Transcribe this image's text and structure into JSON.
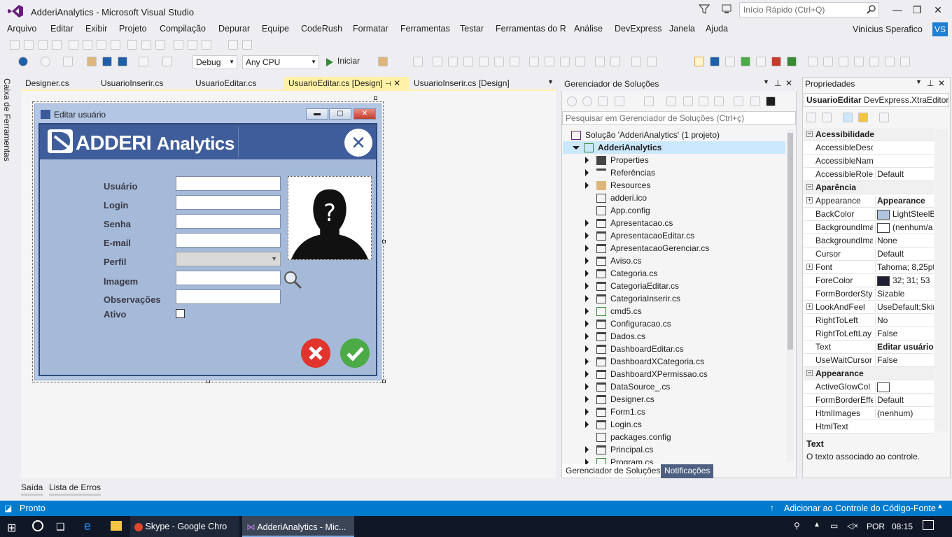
{
  "window": {
    "title": "AdderiAnalytics - Microsoft Visual Studio",
    "quick_launch": "Início Rápido (Ctrl+Q)",
    "user": "Vinícius Sperafico",
    "initials": "VS"
  },
  "menu": [
    "Arquivo",
    "Editar",
    "Exibir",
    "Projeto",
    "Compilação",
    "Depurar",
    "Equipe",
    "CodeRush",
    "Formatar",
    "Ferramentas",
    "Testar",
    "Ferramentas do R",
    "Análise",
    "DevExpress",
    "Janela",
    "Ajuda"
  ],
  "toolbar": {
    "config": "Debug",
    "platform": "Any CPU",
    "start": "Iniciar"
  },
  "toolbox_label": "Caixa de Ferramentas",
  "doc_tabs": [
    "Designer.cs",
    "UsuarioInserir.cs",
    "UsuarioEditar.cs",
    "UsuarioEditar.cs [Design]",
    "UsuarioInserir.cs [Design]"
  ],
  "form": {
    "title": "Editar usuário",
    "logo_main": "ADDERI",
    "logo_sub": "Analytics",
    "fields": [
      "Usuário",
      "Login",
      "Senha",
      "E-mail",
      "Perfil",
      "Imagem",
      "Observações",
      "Ativo"
    ]
  },
  "solution": {
    "title": "Gerenciador de Soluções",
    "search": "Pesquisar em Gerenciador de Soluções (Ctrl+ç)",
    "solution_label": "Solução 'AdderiAnalytics' (1 projeto)",
    "project": "AdderiAnalytics",
    "items": [
      "Properties",
      "Referências",
      "Resources",
      "adderi.ico",
      "App.config",
      "Apresentacao.cs",
      "ApresentacaoEditar.cs",
      "ApresentacaoGerenciar.cs",
      "Aviso.cs",
      "Categoria.cs",
      "CategoriaEditar.cs",
      "CategoriaInserir.cs",
      "cmd5.cs",
      "Configuracao.cs",
      "Dados.cs",
      "DashboardEditar.cs",
      "DashboardXCategoria.cs",
      "DashboardXPermissao.cs",
      "DataSource_.cs",
      "Designer.cs",
      "Form1.cs",
      "Login.cs",
      "packages.config",
      "Principal.cs",
      "Program.cs"
    ],
    "tabs": [
      "Gerenciador de Soluções",
      "Notificações"
    ]
  },
  "properties": {
    "title": "Propriedades",
    "object": "UsuarioEditar",
    "object_type": "DevExpress.XtraEditors",
    "rows": [
      {
        "cat": "Acessibilidade"
      },
      {
        "n": "AccessibleDesc",
        "v": ""
      },
      {
        "n": "AccessibleNam",
        "v": ""
      },
      {
        "n": "AccessibleRole",
        "v": "Default"
      },
      {
        "cat": "Aparência"
      },
      {
        "n": "Appearance",
        "v": "Appearance",
        "plus": true,
        "bold": true
      },
      {
        "n": "BackColor",
        "v": "LightSteelB",
        "swatch": "#b0c4de"
      },
      {
        "n": "BackgroundIma",
        "v": "(nenhum/a",
        "swatch": "#ffffff"
      },
      {
        "n": "BackgroundIma",
        "v": "None"
      },
      {
        "n": "Cursor",
        "v": "Default"
      },
      {
        "n": "Font",
        "v": "Tahoma; 8,25pt",
        "plus": true
      },
      {
        "n": "ForeColor",
        "v": "32; 31; 53",
        "swatch": "#201f35"
      },
      {
        "n": "FormBorderSty",
        "v": "Sizable"
      },
      {
        "n": "LookAndFeel",
        "v": "UseDefault;Skin:",
        "plus": true
      },
      {
        "n": "RightToLeft",
        "v": "No"
      },
      {
        "n": "RightToLeftLay",
        "v": "False"
      },
      {
        "n": "Text",
        "v": "Editar usuário",
        "bold": true
      },
      {
        "n": "UseWaitCursor",
        "v": "False"
      },
      {
        "cat": "Appearance"
      },
      {
        "n": "ActiveGlowCol",
        "v": "",
        "swatch": "#ffffff"
      },
      {
        "n": "FormBorderEffe",
        "v": "Default"
      },
      {
        "n": "HtmlImages",
        "v": "(nenhum)"
      },
      {
        "n": "HtmlText",
        "v": ""
      }
    ],
    "desc_title": "Text",
    "desc_text": "O texto associado ao controle."
  },
  "bottom_tabs": [
    "Saída",
    "Lista de Erros"
  ],
  "status": {
    "left": "Pronto",
    "right": "Adicionar ao Controle do Código-Fonte"
  },
  "taskbar": {
    "apps": [
      "Skype - Google Chro",
      "AdderiAnalytics - Mic..."
    ],
    "lang": "POR",
    "time": "08:15"
  },
  "colors": {
    "accent": "#007acc",
    "doc_tab_active": "#fff1a8",
    "form_back": "#a5bad8"
  }
}
